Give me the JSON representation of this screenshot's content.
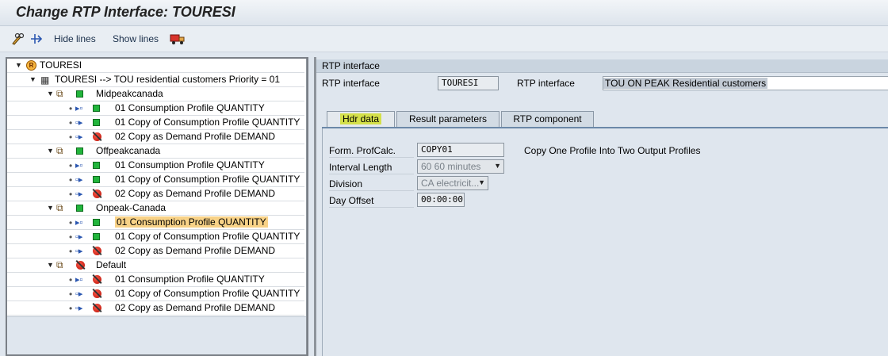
{
  "title": "Change RTP Interface: TOURESI",
  "toolbar": {
    "hide_lines": "Hide lines",
    "show_lines": "Show lines"
  },
  "tree": {
    "root": "TOURESI",
    "interface_line": "TOURESI --> TOU residential customers Priority = 01",
    "groups": [
      {
        "name": "Midpeakcanada",
        "status": "green",
        "items": [
          {
            "label": "01 Consumption Profile QUANTITY",
            "status": "green"
          },
          {
            "label": "01 Copy of Consumption Profile QUANTITY",
            "status": "green"
          },
          {
            "label": "02 Copy as Demand Profile DEMAND",
            "status": "red"
          }
        ]
      },
      {
        "name": "Offpeakcanada",
        "status": "green",
        "items": [
          {
            "label": "01 Consumption Profile QUANTITY",
            "status": "green"
          },
          {
            "label": "01 Copy of Consumption Profile QUANTITY",
            "status": "green"
          },
          {
            "label": "02 Copy as Demand Profile DEMAND",
            "status": "red"
          }
        ]
      },
      {
        "name": "Onpeak-Canada",
        "status": "green",
        "items": [
          {
            "label": "01 Consumption Profile QUANTITY",
            "status": "green",
            "selected": true
          },
          {
            "label": "01 Copy of Consumption Profile QUANTITY",
            "status": "green"
          },
          {
            "label": "02 Copy as Demand Profile DEMAND",
            "status": "red"
          }
        ]
      },
      {
        "name": "Default",
        "status": "red",
        "items": [
          {
            "label": "01 Consumption Profile QUANTITY",
            "status": "red"
          },
          {
            "label": "01 Copy of Consumption Profile QUANTITY",
            "status": "red"
          },
          {
            "label": "02 Copy as Demand Profile DEMAND",
            "status": "red"
          }
        ]
      }
    ]
  },
  "rtp": {
    "section_header": "RTP interface",
    "label1": "RTP interface",
    "value1": "TOURESI",
    "label2": "RTP interface",
    "description": "TOU ON PEAK Residential customers"
  },
  "tabs": [
    "Hdr data",
    "Result parameters",
    "RTP component"
  ],
  "hdr": {
    "form_label": "Form. ProfCalc.",
    "form_value": "COPY01",
    "form_desc": "Copy One Profile Into Two Output Profiles",
    "interval_label": "Interval Length",
    "interval_value": "60 60 minutes",
    "division_label": "Division",
    "division_value": "CA electricit...",
    "dayoffset_label": "Day Offset",
    "dayoffset_value": "00:00:00"
  },
  "colors": {
    "green_status": "#22b53c",
    "red_status": "#d0150a",
    "selection": "#f8d287",
    "active_tab_highlight": "#d4e04a"
  }
}
